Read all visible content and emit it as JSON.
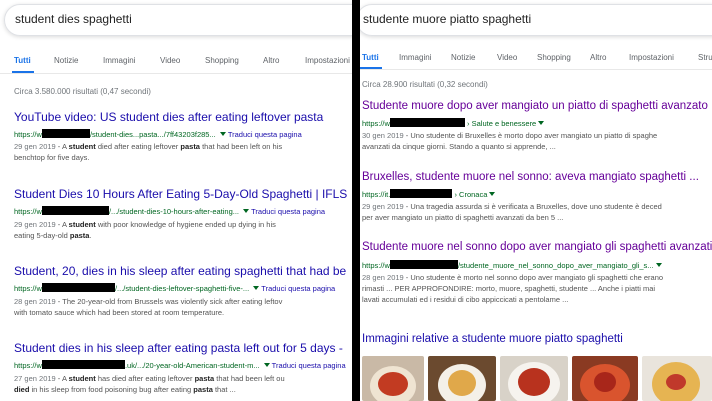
{
  "left": {
    "query": "student dies spaghetti",
    "tabs": [
      "Tutti",
      "Notizie",
      "Immagini",
      "Video",
      "Shopping",
      "Altro",
      "Impostazioni"
    ],
    "stats": "Circa 3.580.000 risultati (0,47 secondi)",
    "results": [
      {
        "title": "YouTube video: US student dies after eating leftover pasta",
        "url_pre": "https://w",
        "url_post": "/student-dies...pasta.../7ff43203f285...",
        "translate": "Traduci questa pagina",
        "date": "29 gen 2019",
        "snippet1_pre": " - A ",
        "snippet1_b1": "student",
        "snippet1_mid": " died after eating leftover ",
        "snippet1_b2": "pasta",
        "snippet1_post": " that had been left on his",
        "snippet2": "benchtop for five days."
      },
      {
        "title": "Student Dies 10 Hours After Eating 5-Day-Old Spaghetti | IFLS",
        "url_pre": "https://w",
        "url_post": "/.../student-dies-10-hours-after-eating...",
        "translate": "Traduci questa pagina",
        "date": "29 gen 2019",
        "snippet1_pre": " - A ",
        "snippet1_b1": "student",
        "snippet1_mid": " with poor knowledge of hygiene ended up dying in his",
        "snippet2_pre": "eating 5-day-old ",
        "snippet2_b": "pasta",
        "snippet2_post": "."
      },
      {
        "title": "Student, 20, dies in his sleep after eating spaghetti that had be",
        "url_pre": "https://w",
        "url_post": "/.../student-dies-leftover-spaghetti-five-...",
        "translate": "Traduci questa pagina",
        "date": "28 gen 2019",
        "snippet1": " - The 20-year-old from Brussels was violently sick after eating leftov",
        "snippet2": "with tomato sauce which had been stored at room temperature."
      },
      {
        "title": "Student dies in his sleep after eating pasta left out for 5 days -",
        "url_pre": "https://w",
        "url_post": ".uk/.../20-year-old-American-student-m...",
        "translate": "Traduci questa pagina",
        "date": "27 gen 2019",
        "snippet1_pre": " - A ",
        "snippet1_b1": "student",
        "snippet1_mid": " has died after eating leftover ",
        "snippet1_b2": "pasta",
        "snippet1_post": " that had been left ou",
        "snippet2_b1": "died",
        "snippet2_mid1": " in his sleep from food poisoning bug after eating ",
        "snippet2_b2": "pasta",
        "snippet2_post": " that ..."
      }
    ]
  },
  "right": {
    "query": "studente muore piatto spaghetti",
    "tabs": [
      "Tutti",
      "Immagini",
      "Notizie",
      "Video",
      "Shopping",
      "Altro",
      "Impostazioni",
      "Stru"
    ],
    "stats": "Circa 28.900 risultati (0,32 secondi)",
    "results": [
      {
        "title": "Studente muore dopo aver mangiato un piatto di spaghetti avanzato ...",
        "url_pre": "https://w",
        "url_post": " › Salute e benessere",
        "date": "30 gen 2019",
        "snippet1": " - Uno studente di Bruxelles è morto dopo aver mangiato un piatto di spaghe",
        "snippet2": "avanzati da cinque giorni. Stando a quanto si apprende, ..."
      },
      {
        "title": "Bruxelles, studente muore nel sonno: aveva mangiato spaghetti ...",
        "url_pre": "https://it.",
        "url_post": " › Cronaca",
        "date": "29 gen 2019",
        "snippet1": " - Una tragedia assurda si è verificata a Bruxelles, dove uno studente è deced",
        "snippet2": "per aver mangiato un piatto di spaghetti avanzati da ben 5 ..."
      },
      {
        "title": "Studente muore nel sonno dopo aver mangiato gli spaghetti avanzati ...",
        "url_pre": "https://w",
        "url_post": "/studente_muore_nel_sonno_dopo_aver_mangiato_gli_s...",
        "date": "28 gen 2019",
        "snippet1": " - Uno studente è morto nel sonno dopo aver mangiato gli spaghetti che erano",
        "snippet2": "rimasti ... PER APPROFONDIRE: morto, muore, spaghetti, studente ... Anche i piatti mai",
        "snippet3": "lavati accumulati ed i residui di cibo appiccicati a pentolame ..."
      }
    ],
    "images_heading": "Immagini relative a studente muore piatto spaghetti"
  }
}
